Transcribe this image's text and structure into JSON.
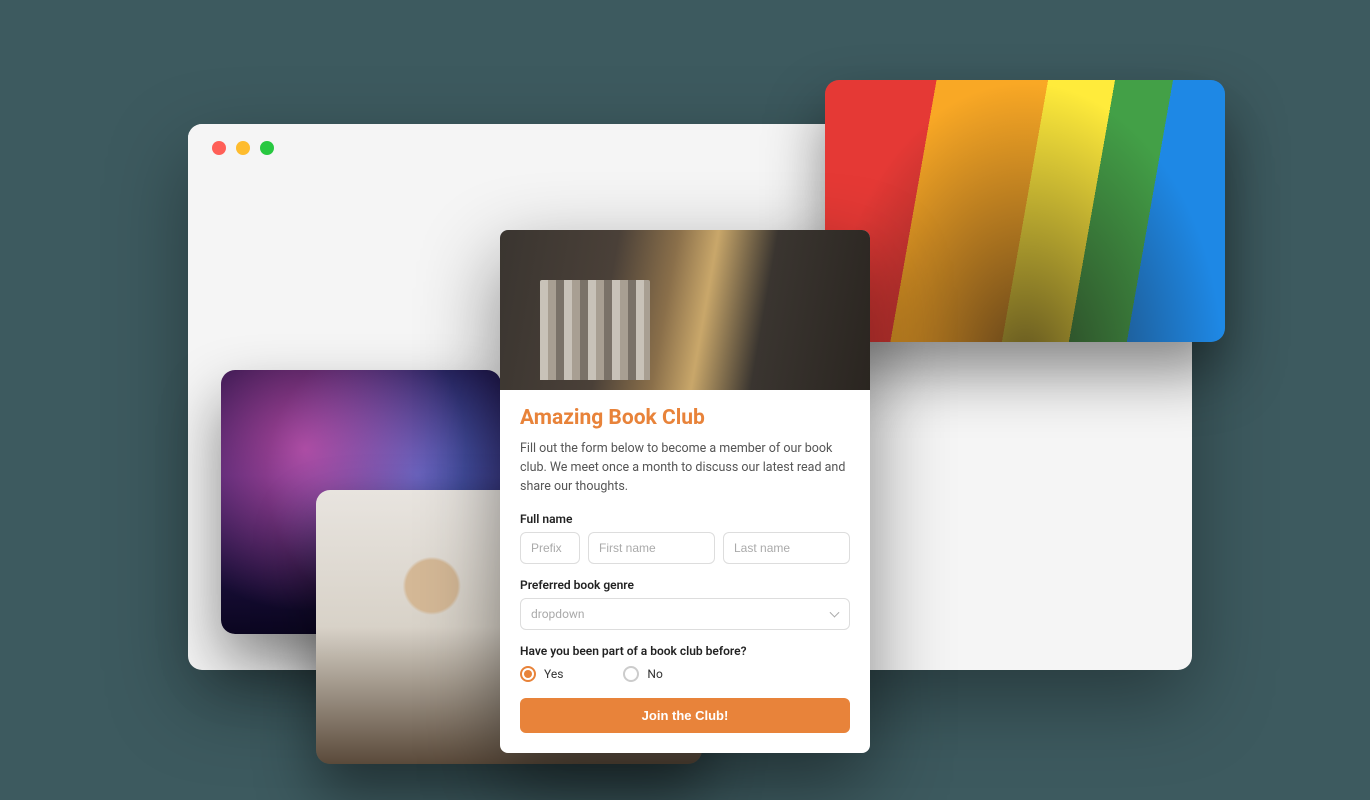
{
  "browser": {
    "traffic_lights": [
      "red",
      "yellow",
      "green"
    ]
  },
  "images": {
    "flag_alt": "Crowd under rainbow flag",
    "concert_alt": "Concert crowd with stage lights",
    "people_alt": "Two people talking over books"
  },
  "form": {
    "title": "Amazing Book Club",
    "description": "Fill out the form below to become a member of our book club. We meet once a month to discuss our latest read and share our thoughts.",
    "fullname_label": "Full name",
    "prefix_placeholder": "Prefix",
    "first_placeholder": "First name",
    "last_placeholder": "Last name",
    "genre_label": "Preferred book genre",
    "genre_placeholder": "dropdown",
    "prior_label": "Have you been part of a book club before?",
    "radio_yes": "Yes",
    "radio_no": "No",
    "radio_selected": "yes",
    "submit_label": "Join the Club!"
  },
  "colors": {
    "accent": "#e8833a",
    "background": "#3d5a5f"
  }
}
